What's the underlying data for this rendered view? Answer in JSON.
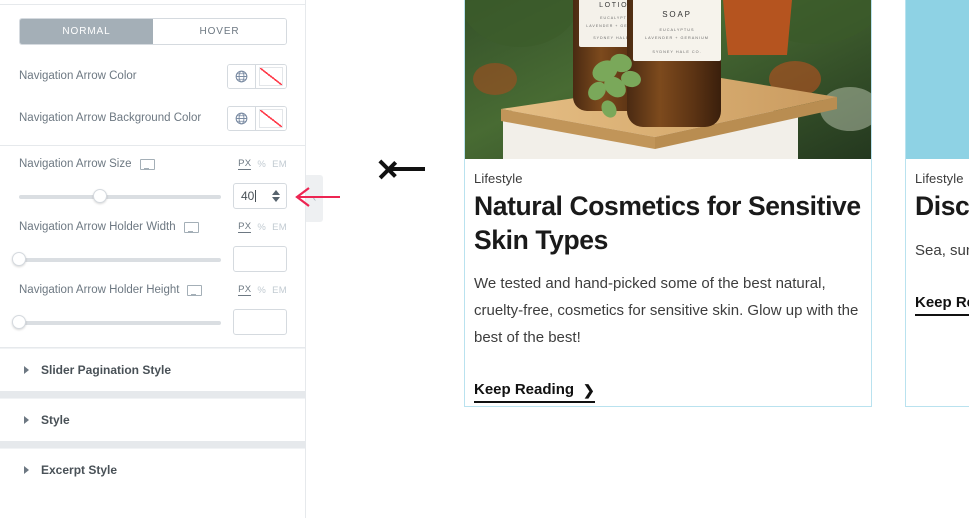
{
  "panel": {
    "style_tabs": [
      {
        "label": "NORMAL",
        "active": true
      },
      {
        "label": "HOVER",
        "active": false
      }
    ],
    "color_controls": [
      {
        "label": "Navigation Arrow Color",
        "globe_icon": "globe-icon",
        "swatch": "no-color-swatch"
      },
      {
        "label": "Navigation Arrow Background Color",
        "globe_icon": "globe-icon",
        "swatch": "no-color-swatch"
      }
    ],
    "slider_controls": [
      {
        "label": "Navigation Arrow Size",
        "device_icon": "desktop-monitor-icon",
        "units": [
          {
            "label": "PX",
            "active": true
          },
          {
            "label": "%",
            "active": false
          },
          {
            "label": "EM",
            "active": false
          }
        ],
        "value": "40",
        "has_caret": true,
        "thumb_percent": 40
      },
      {
        "label": "Navigation Arrow Holder Width",
        "device_icon": "desktop-monitor-icon",
        "units": [
          {
            "label": "PX",
            "active": true
          },
          {
            "label": "%",
            "active": false
          },
          {
            "label": "EM",
            "active": false
          }
        ],
        "value": "",
        "has_caret": false,
        "thumb_percent": 0
      },
      {
        "label": "Navigation Arrow Holder Height",
        "device_icon": "desktop-monitor-icon",
        "units": [
          {
            "label": "PX",
            "active": true
          },
          {
            "label": "%",
            "active": false
          },
          {
            "label": "EM",
            "active": false
          }
        ],
        "value": "",
        "has_caret": false,
        "thumb_percent": 0
      }
    ],
    "sections": [
      {
        "title": "Slider Pagination Style"
      },
      {
        "title": "Style"
      },
      {
        "title": "Excerpt Style"
      }
    ],
    "collapse_handle": {
      "icon": "chevron-left-icon",
      "glyph": "‹"
    }
  },
  "preview": {
    "nav_arrow": {
      "icon": "arrow-left-icon"
    },
    "annotation": {
      "icon": "red-arrow-left-annotation",
      "color": "#ed2552"
    },
    "cards": [
      {
        "image": "product-bottles-lotion-soap-photo",
        "category": "Lifestyle",
        "title": "Natural Cosmetics for Sensitive Skin Types",
        "excerpt": "We tested and hand-picked some of the best natural, cruelty-free, cosmetics for sensitive skin. Glow up with the best of the best!",
        "read_more": "Keep Reading",
        "read_more_icon": "chevron-right-icon"
      },
      {
        "image": "ice-cream-blue-background-photo",
        "category": "Lifestyle",
        "title": "Discover Summer",
        "excerpt": "Sea, sun, See our e destinati",
        "read_more": "Keep Reading",
        "read_more_icon": "chevron-right-icon"
      }
    ]
  },
  "colors": {
    "tab_active_bg": "#a4afb7",
    "card_border": "#b9e2ef",
    "annotation_red": "#ed2552",
    "no_color_red": "#ff3b4a"
  }
}
